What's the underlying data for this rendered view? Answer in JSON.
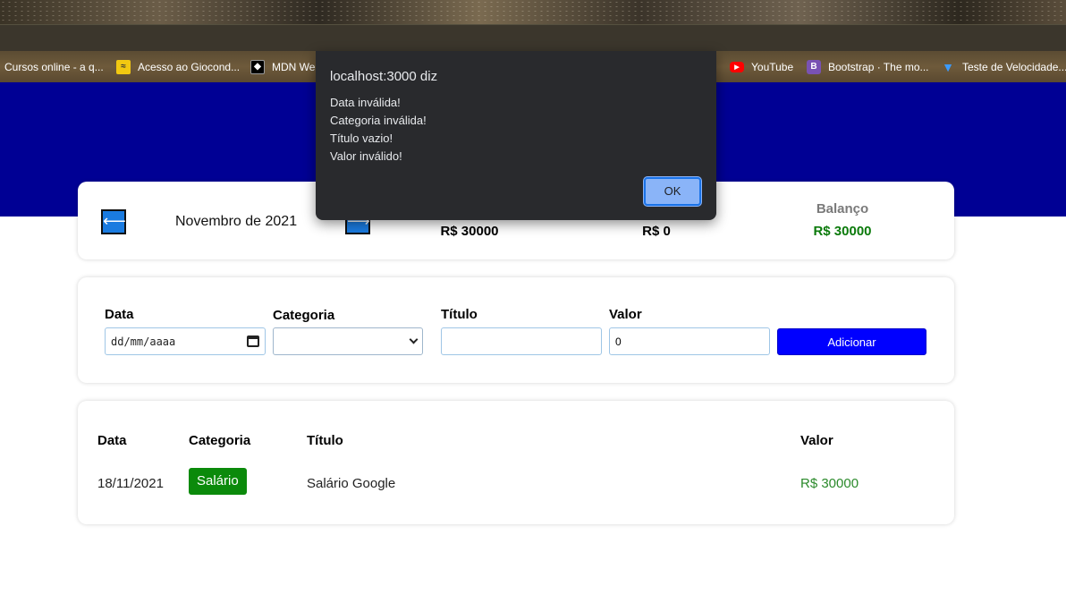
{
  "browser": {
    "bookmarks": [
      {
        "label": "Cursos online - a q...",
        "icon": "cursos-icon"
      },
      {
        "label": "Acesso ao Giocond...",
        "icon": "giocond-icon"
      },
      {
        "label": "MDN We",
        "icon": "mdn-icon"
      },
      {
        "label": "YouTube",
        "icon": "youtube-icon"
      },
      {
        "label": "Bootstrap · The mo...",
        "icon": "bootstrap-icon"
      },
      {
        "label": "Teste de Velocidade...",
        "icon": "speedtest-icon"
      }
    ]
  },
  "summary": {
    "prev_arrow": "⟵",
    "next_arrow": "⟶",
    "month": "Novembro de 2021",
    "income_value": "R$ 30000",
    "expense_value": "R$ 0",
    "balance_label": "Balanço",
    "balance_value": "R$ 30000",
    "balance_color": "#0b7a0b"
  },
  "form": {
    "date_label": "Data",
    "date_placeholder": "dd/mm/aaaa",
    "category_label": "Categoria",
    "category_value": "",
    "title_label": "Título",
    "title_value": "",
    "value_label": "Valor",
    "value_value": "0",
    "add_button": "Adicionar"
  },
  "table": {
    "headers": {
      "date": "Data",
      "category": "Categoria",
      "title": "Título",
      "value": "Valor"
    },
    "rows": [
      {
        "date": "18/11/2021",
        "category": "Salário",
        "title": "Salário Google",
        "value": "R$ 30000"
      }
    ]
  },
  "dialog": {
    "title": "localhost:3000 diz",
    "messages": [
      "Data inválida!",
      "Categoria inválida!",
      "Título vazio!",
      "Valor inválido!"
    ],
    "ok": "OK"
  },
  "colors": {
    "header": "#000094",
    "accent": "#0000ff",
    "income": "#0b8a0b"
  }
}
